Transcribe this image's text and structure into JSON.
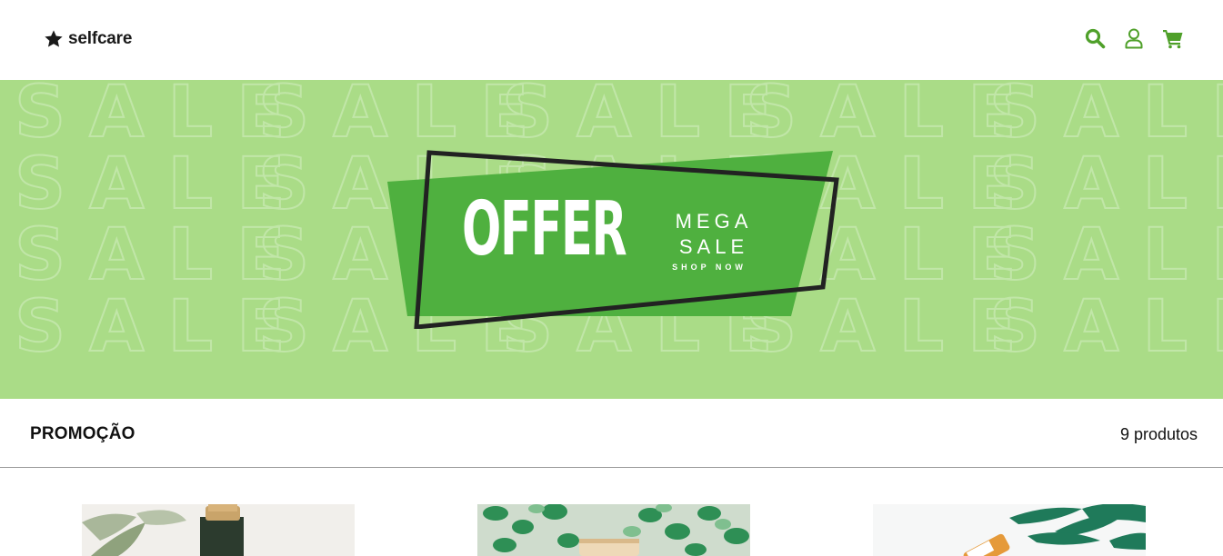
{
  "header": {
    "logo_text": "selfcare",
    "logo_icon": "star-icon",
    "icons": [
      "search-icon",
      "user-icon",
      "cart-icon"
    ],
    "accent_color": "#4fa02a"
  },
  "banner": {
    "pattern_word": "SALE",
    "offer_text": "OFFER",
    "mega_line1": "MEGA",
    "mega_line2": "SALE",
    "shop_now": "SHOP NOW",
    "background_color": "#aadc87",
    "badge_color": "#4fb03f"
  },
  "section": {
    "title": "PROMOÇÃO",
    "count_text": "9 produtos"
  },
  "products": [
    {
      "image": "product-bottle-image"
    },
    {
      "image": "product-jar-plants-image"
    },
    {
      "image": "product-bottle-leaves-image"
    }
  ]
}
